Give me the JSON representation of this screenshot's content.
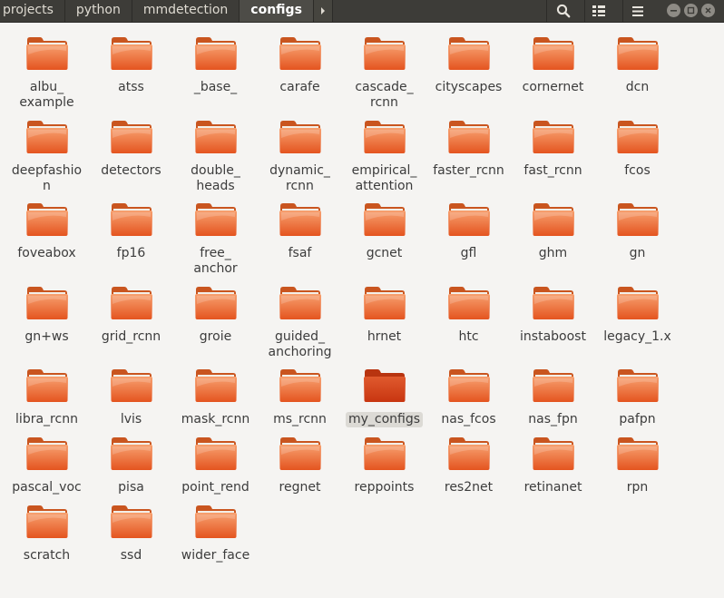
{
  "header": {
    "breadcrumbs": [
      "projects",
      "python",
      "mmdetection",
      "configs"
    ],
    "active_crumb": "configs"
  },
  "icons": {
    "search": "search-icon",
    "view": "grid-view-icon",
    "menu": "hamburger-menu-icon",
    "folder": "folder-icon"
  },
  "colors": {
    "header_bg": "#3d3c38",
    "folder_orange": "#f07746",
    "folder_selected": "#d5401a",
    "content_bg": "#f5f4f2"
  },
  "folders": [
    {
      "label": "albu_\nexample"
    },
    {
      "label": "atss"
    },
    {
      "label": "_base_"
    },
    {
      "label": "carafe"
    },
    {
      "label": "cascade_\nrcnn"
    },
    {
      "label": "cityscapes"
    },
    {
      "label": "cornernet"
    },
    {
      "label": "dcn"
    },
    {
      "label": "deepfashio\nn"
    },
    {
      "label": "detectors"
    },
    {
      "label": "double_\nheads"
    },
    {
      "label": "dynamic_\nrcnn"
    },
    {
      "label": "empirical_\nattention"
    },
    {
      "label": "faster_rcnn"
    },
    {
      "label": "fast_rcnn"
    },
    {
      "label": "fcos"
    },
    {
      "label": "foveabox"
    },
    {
      "label": "fp16"
    },
    {
      "label": "free_\nanchor"
    },
    {
      "label": "fsaf"
    },
    {
      "label": "gcnet"
    },
    {
      "label": "gfl"
    },
    {
      "label": "ghm"
    },
    {
      "label": "gn"
    },
    {
      "label": "gn+ws"
    },
    {
      "label": "grid_rcnn"
    },
    {
      "label": "groie"
    },
    {
      "label": "guided_\nanchoring"
    },
    {
      "label": "hrnet"
    },
    {
      "label": "htc"
    },
    {
      "label": "instaboost"
    },
    {
      "label": "legacy_1.x"
    },
    {
      "label": "libra_rcnn"
    },
    {
      "label": "lvis"
    },
    {
      "label": "mask_rcnn"
    },
    {
      "label": "ms_rcnn"
    },
    {
      "label": "my_configs",
      "selected": true
    },
    {
      "label": "nas_fcos"
    },
    {
      "label": "nas_fpn"
    },
    {
      "label": "pafpn"
    },
    {
      "label": "pascal_voc"
    },
    {
      "label": "pisa"
    },
    {
      "label": "point_rend"
    },
    {
      "label": "regnet"
    },
    {
      "label": "reppoints"
    },
    {
      "label": "res2net"
    },
    {
      "label": "retinanet"
    },
    {
      "label": "rpn"
    },
    {
      "label": "scratch"
    },
    {
      "label": "ssd"
    },
    {
      "label": "wider_face"
    }
  ]
}
